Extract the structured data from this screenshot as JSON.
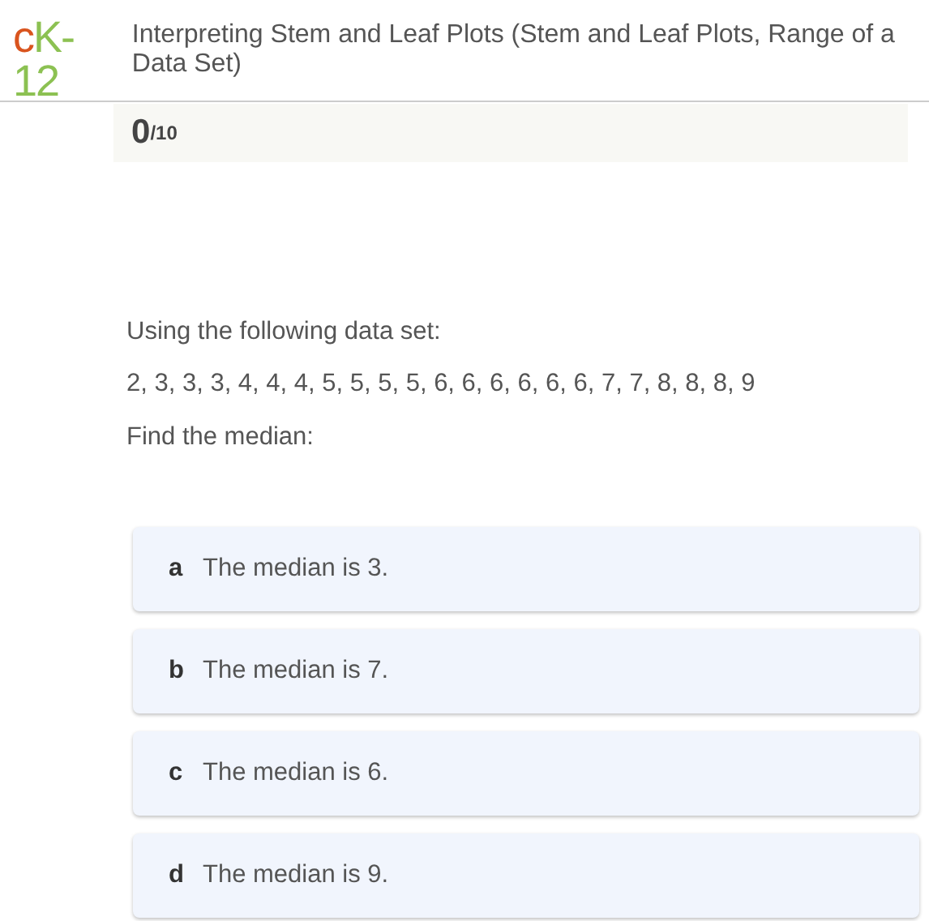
{
  "logo": [
    {
      "text": "c",
      "color": "#d9541e"
    },
    {
      "text": "K-12",
      "color": "#8cc152"
    }
  ],
  "title": "Interpreting Stem and Leaf Plots (Stem and Leaf Plots, Range of a Data Set)",
  "score": {
    "value": "0",
    "total": "/10"
  },
  "question": [
    "Using the following data set:",
    "2, 3, 3, 3, 4, 4, 4, 5, 5, 5, 5, 6, 6, 6, 6, 6, 6, 7, 7, 8, 8, 8, 9",
    "Find the median:"
  ],
  "choices": [
    {
      "letter": "a",
      "text": "The median is 3."
    },
    {
      "letter": "b",
      "text": "The median is 7."
    },
    {
      "letter": "c",
      "text": "The median is 6."
    },
    {
      "letter": "d",
      "text": "The median is 9."
    }
  ]
}
